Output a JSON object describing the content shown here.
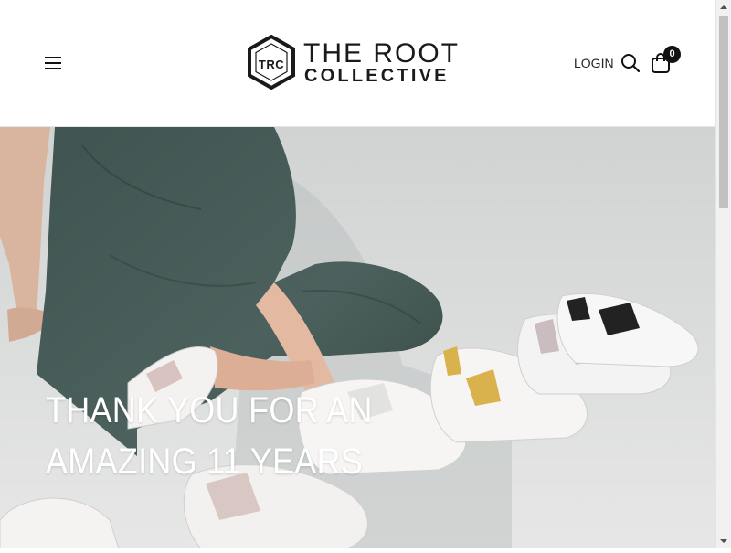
{
  "header": {
    "menu_icon": "hamburger-menu-icon",
    "logo": {
      "monogram": "TRC",
      "line1": "THE ROOT",
      "line2": "COLLECTIVE"
    },
    "login_label": "LOGIN",
    "search_icon": "search-icon",
    "cart_icon": "shopping-bag-icon",
    "cart_count": "0"
  },
  "hero": {
    "title_line1": "THANK YOU FOR AN",
    "title_line2": "AMAZING 11 YEARS",
    "image_subject": "person in denim jumpsuit seated beside rows of white leather sneakers",
    "text_color": "#ffffff"
  },
  "colors": {
    "header_bg": "#ffffff",
    "brand_dark": "#1a1a1a",
    "hero_bg": "#d8dad9"
  }
}
